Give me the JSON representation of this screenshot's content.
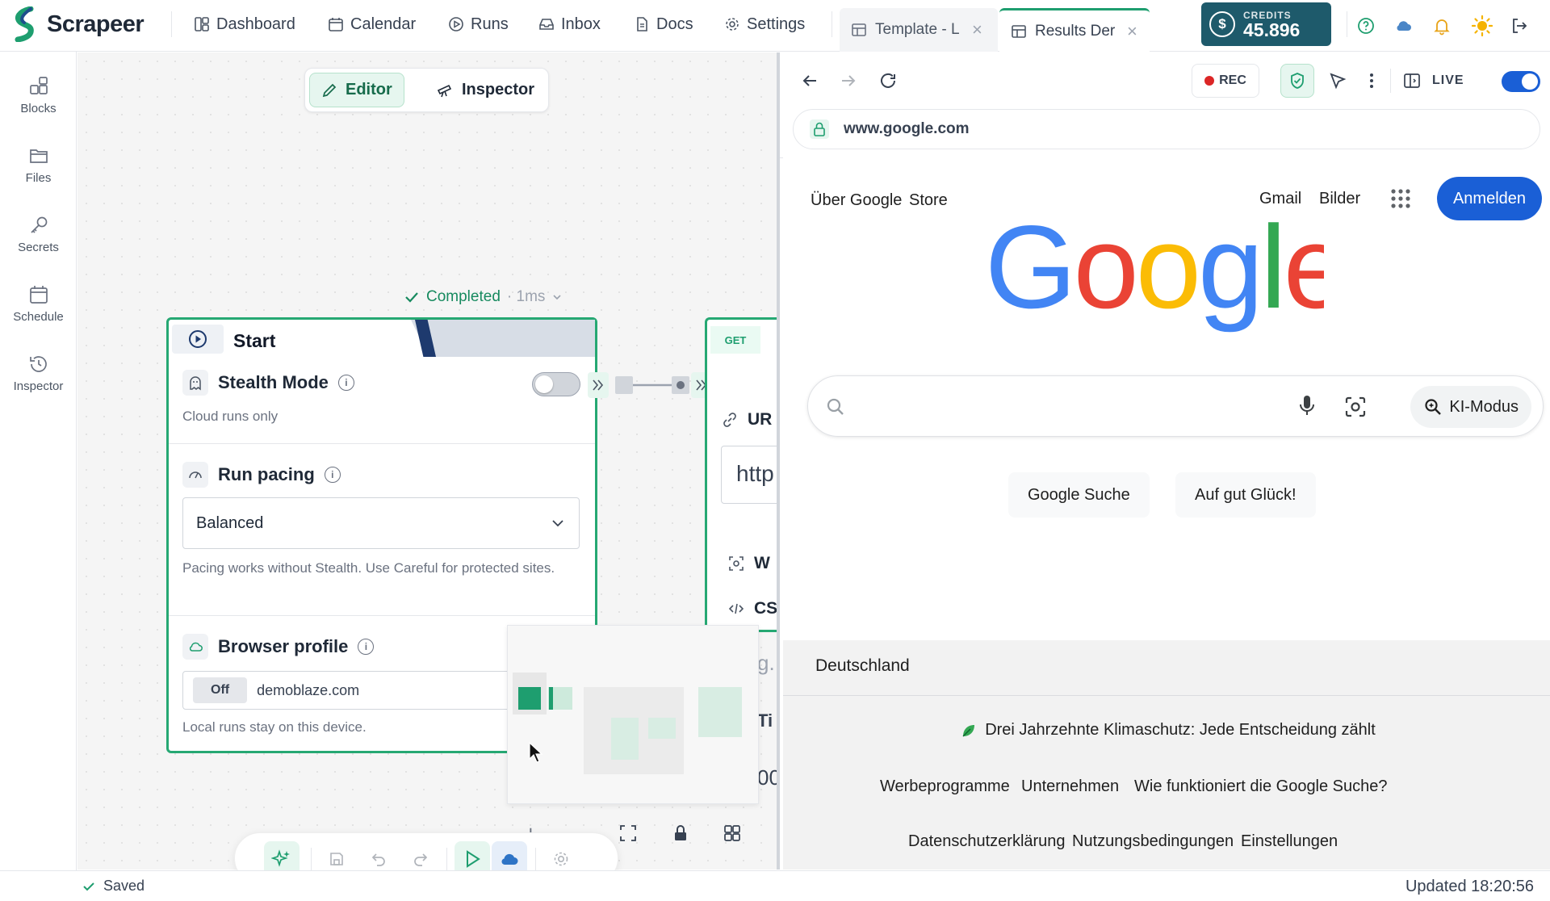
{
  "app": {
    "name": "Scrapeer"
  },
  "nav": {
    "items": [
      "Dashboard",
      "Calendar",
      "Runs",
      "Inbox",
      "Docs",
      "Settings"
    ]
  },
  "tabs": [
    {
      "label": "Template - L",
      "active": false
    },
    {
      "label": "Results Der",
      "active": true
    }
  ],
  "credits": {
    "label": "CREDITS",
    "value": "45.896",
    "symbol": "$"
  },
  "sidebar": {
    "items": [
      "Blocks",
      "Files",
      "Secrets",
      "Schedule",
      "Inspector"
    ],
    "more": "…"
  },
  "editor": {
    "mode_editor": "Editor",
    "mode_inspector": "Inspector",
    "status": "Completed",
    "duration": "· 1ms",
    "start_node": {
      "title": "Start",
      "stealth": {
        "title": "Stealth Mode",
        "hint": "Cloud runs only",
        "enabled": false
      },
      "pacing": {
        "title": "Run pacing",
        "value": "Balanced",
        "hint": "Pacing works without Stealth. Use Careful for protected sites."
      },
      "profile": {
        "title": "Browser profile",
        "toggle": "Off",
        "value": "demoblaze.com",
        "hint": "Local runs stay on this device."
      }
    },
    "get_node": {
      "method": "GET",
      "field1": "UR",
      "input_value": "http",
      "field2": "W",
      "field3": "CS",
      "field4": "g.",
      "field5": "Ti",
      "field6": "00"
    }
  },
  "status_bar": {
    "saved": "Saved",
    "updated": "Updated 18:20:56"
  },
  "browser": {
    "rec": "REC",
    "live": "LIVE",
    "live_on": true,
    "url": "www.google.com",
    "google": {
      "top_left": [
        "Über Google",
        "Store"
      ],
      "top_right": [
        "Gmail",
        "Bilder"
      ],
      "signin": "Anmelden",
      "logo": "Google",
      "ai_mode": "KI-Modus",
      "buttons": [
        "Google Suche",
        "Auf gut Glück!"
      ],
      "country": "Deutschland",
      "climate": "Drei Jahrzehnte Klimaschutz: Jede Entscheidung zählt",
      "footer_row1": [
        "Werbeprogramme",
        "Unternehmen",
        "Wie funktioniert die Google Suche?"
      ],
      "footer_row2": [
        "Datenschutzerklärung",
        "Nutzungsbedingungen",
        "Einstellungen"
      ]
    }
  },
  "colors": {
    "accent": "#1e9e6f",
    "credits_bg": "#1e5a6b",
    "google_blue": "#1a5fd6"
  }
}
